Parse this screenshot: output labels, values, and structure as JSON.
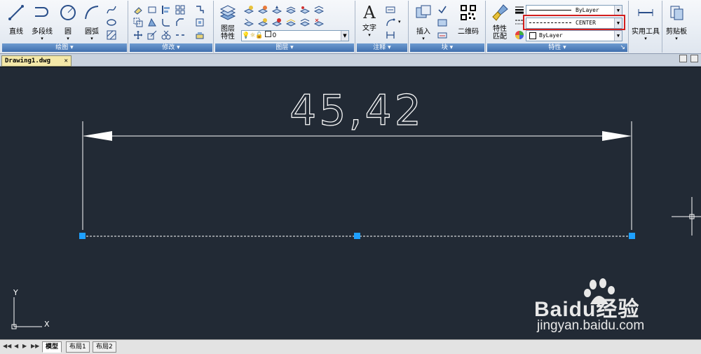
{
  "ribbon": {
    "draw": {
      "title": "绘图",
      "line_label": "直线",
      "polyline_label": "多段线",
      "circle_label": "圆",
      "arc_label": "圆弧"
    },
    "modify": {
      "title": "修改"
    },
    "layers": {
      "title": "图层",
      "layer_props_label": "图层\n特性",
      "current_layer": "0"
    },
    "annotation": {
      "title": "注释",
      "text_label": "文字"
    },
    "block": {
      "title": "块",
      "insert_label": "插入",
      "qr_label": "二维码"
    },
    "properties": {
      "title": "特性",
      "match_label": "特性\n匹配",
      "color_value": "ByLayer",
      "linetype_value": "CENTER",
      "lineweight_value": "ByLayer"
    },
    "utilities_label": "实用工具",
    "clipboard_label": "剪贴板",
    "accent": "#3f6fae",
    "highlight_color": "#d21f1f"
  },
  "doc_tab": {
    "label": "Drawing1.dwg"
  },
  "canvas": {
    "bg": "#222a35",
    "dimension_text": "45,42",
    "ucs_x": "X",
    "ucs_y": "Y"
  },
  "layout_tabs": [
    "模型",
    "布局1",
    "布局2"
  ],
  "watermark": {
    "brand": "Baidu经验",
    "url": "jingyan.baidu.com"
  }
}
